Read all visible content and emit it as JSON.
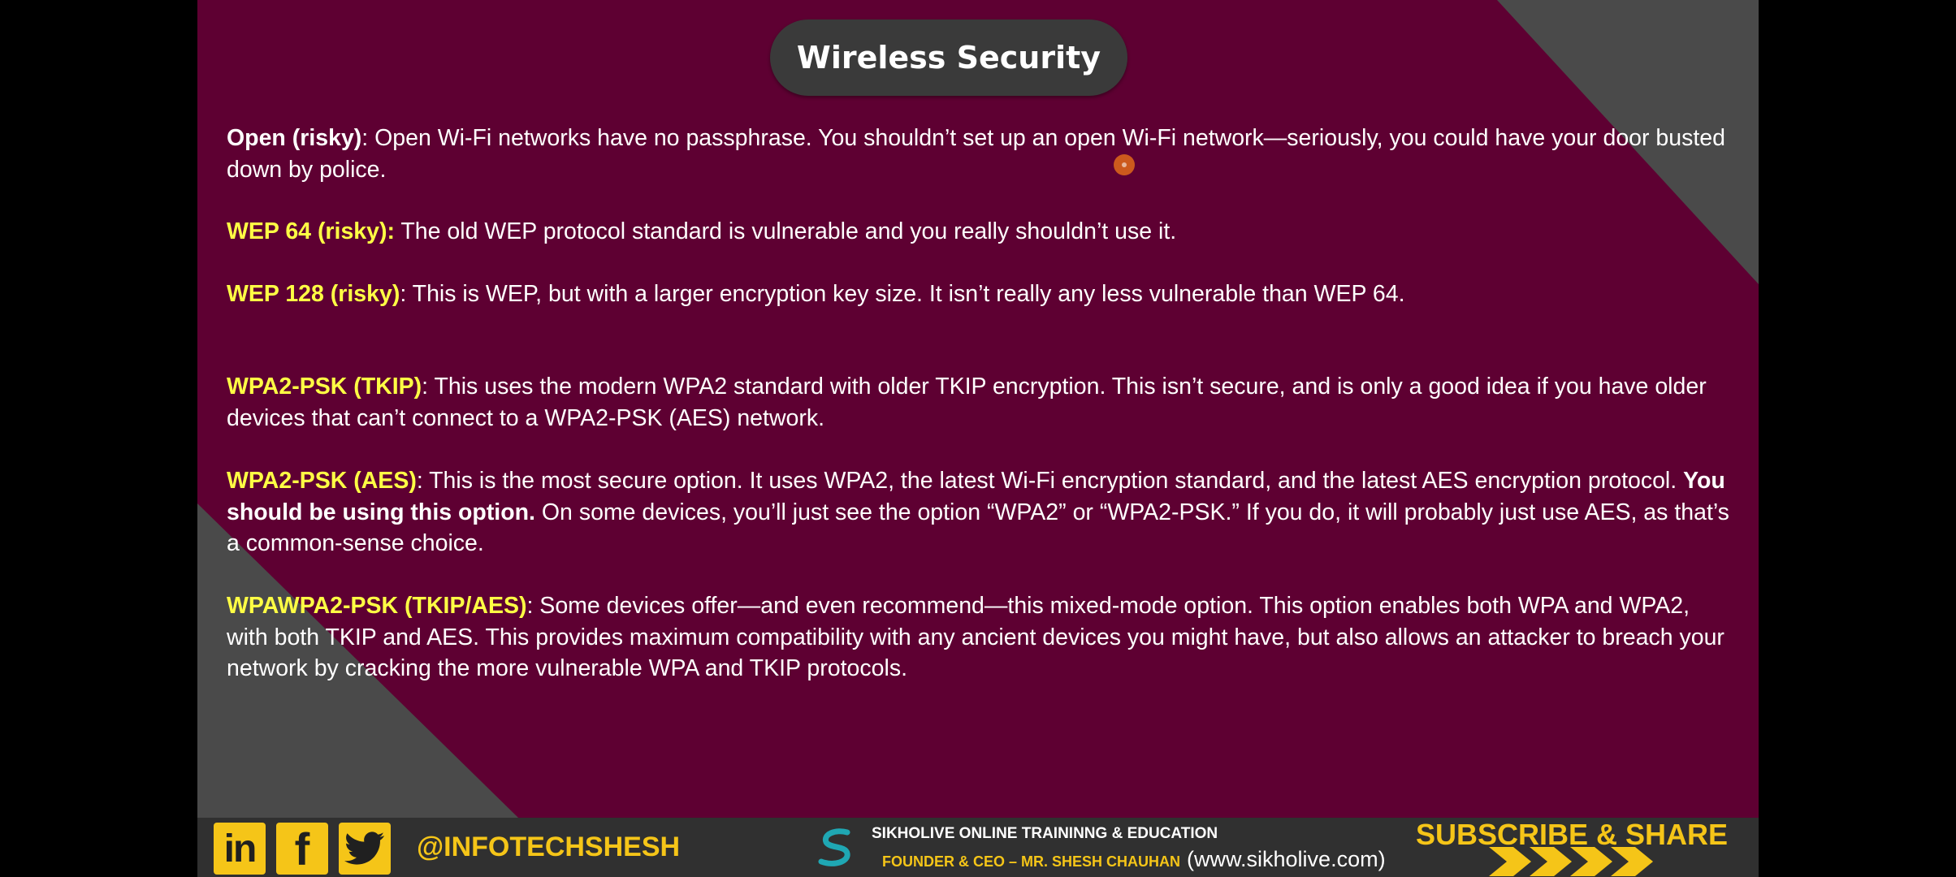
{
  "slide": {
    "title": "Wireless Security"
  },
  "paragraphs": {
    "open": {
      "term": "Open (risky)",
      "text": ": Open Wi-Fi networks have no passphrase. You shouldn’t set up an open Wi-Fi network—seriously, you could have your door busted down by police."
    },
    "wep64": {
      "term": "WEP 64 (risky):",
      "text": " The old WEP protocol standard is vulnerable and you really shouldn’t use it."
    },
    "wep128": {
      "term": "WEP 128 (risky)",
      "text": ": This is WEP, but with a larger encryption key size. It isn’t really any less vulnerable than WEP 64."
    },
    "tkip": {
      "term": "WPA2-PSK (TKIP)",
      "text": ": This uses the modern WPA2 standard with older TKIP encryption. This isn’t secure, and is only a good idea if you have older devices that can’t connect to a WPA2-PSK (AES) network."
    },
    "aes": {
      "term": "WPA2-PSK (AES)",
      "text_before": ": This is the most secure option. It uses WPA2, the latest Wi-Fi encryption standard, and the latest AES encryption protocol. ",
      "emphasis": "You should be using this option.",
      "text_after": " On some devices, you’ll just see the option “WPA2” or “WPA2-PSK.” If you do, it will probably just use AES, as that’s a common-sense choice."
    },
    "mixed": {
      "term": "WPAWPA2-PSK (TKIP/AES)",
      "text": ": Some devices offer—and even recommend—this mixed-mode option. This option enables both WPA and WPA2, with both TKIP and AES. This provides maximum compatibility with any ancient devices you might have, but also allows an attacker to breach your network by cracking the more vulnerable WPA and TKIP protocols."
    }
  },
  "footer": {
    "linkedin_label": "in",
    "facebook_label": "f",
    "handle": "@INFOTECHSHESH",
    "org": "SIKHOLIVE ONLINE TRAININNG & EDUCATION",
    "founder": "FOUNDER & CEO – MR. SHESH CHAUHAN",
    "website": "(www.sikholive.com)",
    "subscribe": "SUBSCRIBE & SHARE"
  },
  "colors": {
    "slide_background": "#5e0032",
    "highlight": "#ffff44",
    "footer_accent": "#f5c518",
    "footer_background": "#303030"
  },
  "icons": [
    "linkedin-icon",
    "facebook-icon",
    "twitter-icon",
    "sikholive-logo-icon",
    "double-chevron-icon"
  ]
}
